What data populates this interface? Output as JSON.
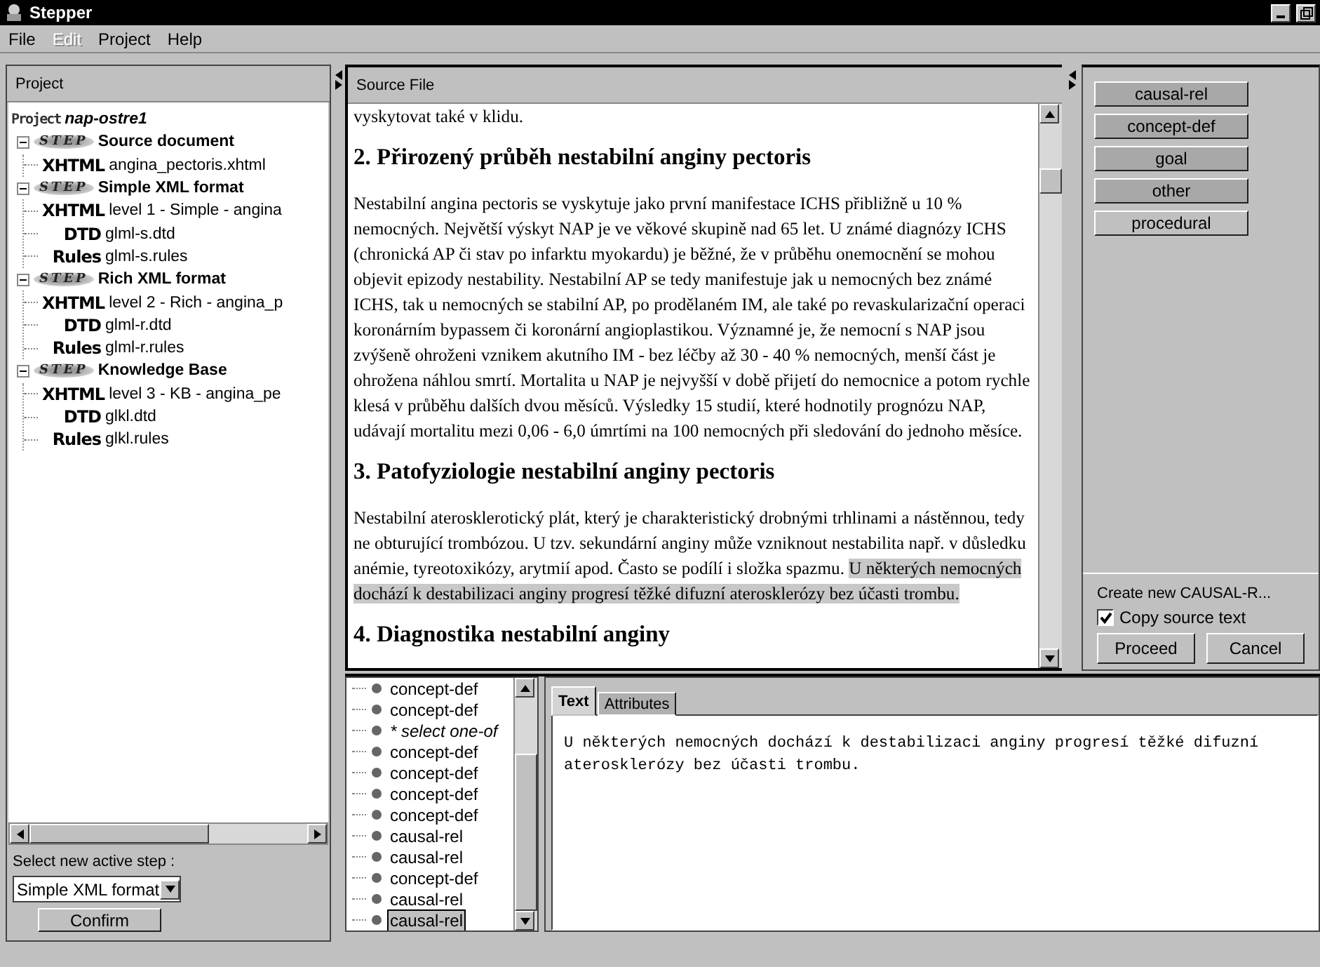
{
  "window": {
    "title": "Stepper"
  },
  "menu": [
    {
      "label": "File",
      "disabled": false
    },
    {
      "label": "Edit",
      "disabled": true
    },
    {
      "label": "Project",
      "disabled": false
    },
    {
      "label": "Help",
      "disabled": false
    }
  ],
  "project_panel": {
    "title": "Project",
    "tree": {
      "kind": "project",
      "logo": "Project",
      "label": "nap-ostre1",
      "children": [
        {
          "kind": "step",
          "logo": "STEP",
          "label": "Source document",
          "expanded": true,
          "children": [
            {
              "kind": "file",
              "type": "XHTML",
              "label": "angina_pectoris.xhtml"
            }
          ]
        },
        {
          "kind": "step",
          "logo": "STEP",
          "label": "Simple XML format",
          "expanded": true,
          "children": [
            {
              "kind": "file",
              "type": "XHTML",
              "label": "level 1 - Simple - angina"
            },
            {
              "kind": "file",
              "type": "DTD",
              "label": "glml-s.dtd"
            },
            {
              "kind": "file",
              "type": "Rules",
              "label": "glml-s.rules"
            }
          ]
        },
        {
          "kind": "step",
          "logo": "STEP",
          "label": "Rich XML format",
          "expanded": true,
          "children": [
            {
              "kind": "file",
              "type": "XHTML",
              "label": "level 2 - Rich - angina_p"
            },
            {
              "kind": "file",
              "type": "DTD",
              "label": "glml-r.dtd"
            },
            {
              "kind": "file",
              "type": "Rules",
              "label": "glml-r.rules"
            }
          ]
        },
        {
          "kind": "step",
          "logo": "STEP",
          "label": "Knowledge Base",
          "expanded": true,
          "children": [
            {
              "kind": "file",
              "type": "XHTML",
              "label": "level 3 - KB - angina_pe"
            },
            {
              "kind": "file",
              "type": "DTD",
              "label": "glkl.dtd"
            },
            {
              "kind": "file",
              "type": "Rules",
              "label": "glkl.rules"
            }
          ]
        }
      ]
    },
    "step_label": "Select new active step :",
    "step_value": "Simple XML format",
    "confirm": "Confirm"
  },
  "source_panel": {
    "title": "Source File",
    "blocks": [
      {
        "kind": "paragraph",
        "segments": [
          {
            "text": "vyskytovat také v klidu.",
            "highlighted": false
          }
        ]
      },
      {
        "kind": "heading",
        "text": "2. Přirozený průběh nestabilní anginy pectoris"
      },
      {
        "kind": "paragraph",
        "segments": [
          {
            "text": "Nestabilní angina pectoris se vyskytuje jako první manifestace ICHS přibližně u 10 % nemocných. Největší výskyt NAP je ve věkové skupině nad 65 let. U známé diagnózy ICHS (chronická AP či stav po infarktu myokardu) je běžné, že v průběhu onemocnění se mohou objevit epizody nestability. Nestabilní AP se tedy manifestuje jak u nemocných bez známé ICHS, tak u nemocných se stabilní AP, po prodělaném IM, ale také po revaskularizační operaci koronárním bypassem či koronární angioplastikou. Významné je, že nemocní s NAP jsou zvýšeně ohroženi vznikem akutního IM - bez léčby až 30 - 40 % nemocných, menší část je ohrožena náhlou smrtí. Mortalita u NAP je nejvyšší v době přijetí do nemocnice a potom rychle klesá v průběhu dalších dvou měsíců. Výsledky 15 studií, které hodnotily prognózu NAP, udávají mortalitu mezi 0,06 - 6,0 úmrtími na 100 nemocných při sledování do jednoho měsíce.",
            "highlighted": false
          }
        ]
      },
      {
        "kind": "heading",
        "text": "3. Patofyziologie nestabilní anginy pectoris"
      },
      {
        "kind": "paragraph",
        "segments": [
          {
            "text": "Nestabilní aterosklerotický plát, který je charakteristický drobnými trhlinami a nástěnnou, tedy ne obturující trombózou. U tzv. sekundární anginy může vzniknout nestabilita např. v důsledku anémie, tyreotoxikózy, arytmií apod. Často se podílí i složka spazmu. ",
            "highlighted": false
          },
          {
            "text": "U některých nemocných dochází k destabilizaci anginy progresí těžké difuzní aterosklerózy bez účasti trombu.",
            "highlighted": true
          }
        ]
      },
      {
        "kind": "heading",
        "text": "4. Diagnostika nestabilní anginy"
      }
    ]
  },
  "tag_buttons": [
    {
      "label": "causal-rel",
      "active": true
    },
    {
      "label": "concept-def",
      "active": true
    },
    {
      "label": "goal",
      "active": true
    },
    {
      "label": "other",
      "active": true
    },
    {
      "label": "procedural",
      "active": false
    }
  ],
  "create_panel": {
    "label": "Create new CAUSAL-R...",
    "copy_source_text": {
      "label": "Copy source text",
      "checked": true
    },
    "buttons": [
      "Proceed",
      "Cancel"
    ]
  },
  "element_list": [
    {
      "label": "concept-def",
      "kind": "element",
      "selected": false
    },
    {
      "label": "concept-def",
      "kind": "element",
      "selected": false
    },
    {
      "label": "* select one-of",
      "kind": "choice",
      "selected": false
    },
    {
      "label": "concept-def",
      "kind": "element",
      "selected": false
    },
    {
      "label": "concept-def",
      "kind": "element",
      "selected": false
    },
    {
      "label": "concept-def",
      "kind": "element",
      "selected": false
    },
    {
      "label": "concept-def",
      "kind": "element",
      "selected": false
    },
    {
      "label": "causal-rel",
      "kind": "element",
      "selected": false
    },
    {
      "label": "causal-rel",
      "kind": "element",
      "selected": false
    },
    {
      "label": "concept-def",
      "kind": "element",
      "selected": false
    },
    {
      "label": "causal-rel",
      "kind": "element",
      "selected": false
    },
    {
      "label": "causal-rel",
      "kind": "element",
      "selected": true
    }
  ],
  "detail_tabs": [
    {
      "label": "Text",
      "selected": true
    },
    {
      "label": "Attributes",
      "selected": false
    }
  ],
  "detail_text": "U některých nemocných dochází k destabilizaci anginy progresí těžké difuzní aterosklerózy bez účasti trombu."
}
